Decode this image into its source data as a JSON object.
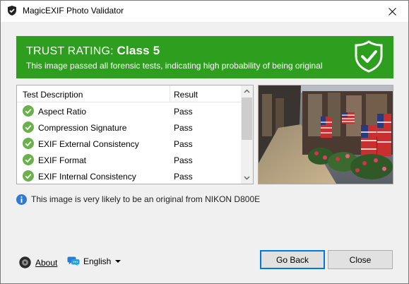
{
  "window": {
    "title": "MagicEXIF Photo Validator"
  },
  "banner": {
    "rating_prefix": "TRUST RATING:",
    "rating_value": "Class 5",
    "subtitle": "This image passed all forensic tests, indicating high probability of being original",
    "color": "#2e9e1e"
  },
  "table": {
    "columns": [
      "Test Description",
      "Result"
    ],
    "rows": [
      {
        "description": "Aspect Ratio",
        "result": "Pass",
        "icon": "check-circle-icon"
      },
      {
        "description": "Compression Signature",
        "result": "Pass",
        "icon": "check-circle-icon"
      },
      {
        "description": "EXIF External Consistency",
        "result": "Pass",
        "icon": "check-circle-icon"
      },
      {
        "description": "EXIF Format",
        "result": "Pass",
        "icon": "check-circle-icon"
      },
      {
        "description": "EXIF Internal Consistency",
        "result": "Pass",
        "icon": "check-circle-icon"
      }
    ]
  },
  "info": {
    "text": "This image is very likely to be an original from NIKON D800E",
    "icon": "info-icon"
  },
  "footer": {
    "about_label": "About",
    "language_label": "English",
    "go_back_label": "Go Back",
    "close_label": "Close"
  }
}
